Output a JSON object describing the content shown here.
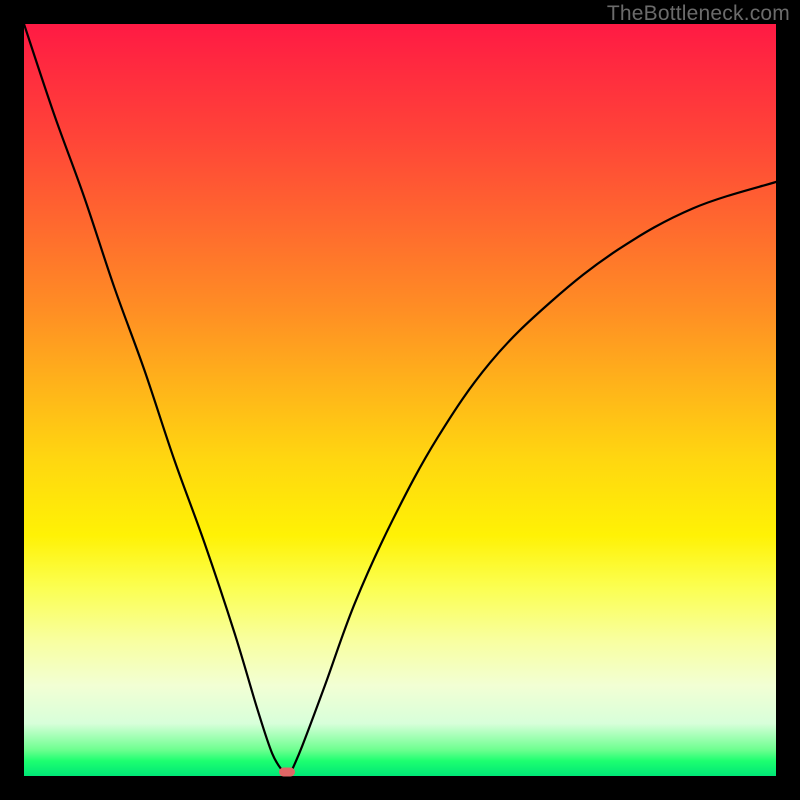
{
  "watermark": "TheBottleneck.com",
  "colors": {
    "frame": "#000000",
    "curve": "#000000",
    "marker": "#e06666"
  },
  "chart_data": {
    "type": "line",
    "title": "",
    "xlabel": "",
    "ylabel": "",
    "xlim": [
      0,
      100
    ],
    "ylim": [
      0,
      100
    ],
    "grid": false,
    "legend": false,
    "series": [
      {
        "name": "left-branch",
        "x": [
          0,
          4,
          8,
          12,
          16,
          20,
          24,
          28,
          31,
          33,
          34.5
        ],
        "values": [
          100,
          88,
          77,
          65,
          54,
          42,
          31,
          19,
          9,
          3,
          0.5
        ]
      },
      {
        "name": "right-branch",
        "x": [
          35.5,
          37,
          40,
          44,
          49,
          55,
          62,
          70,
          79,
          89,
          100
        ],
        "values": [
          0.5,
          4,
          12,
          23,
          34,
          45,
          55,
          63,
          70,
          75.5,
          79
        ]
      }
    ],
    "annotations": [
      {
        "name": "min-marker",
        "x": 35,
        "y": 0.5
      }
    ]
  }
}
